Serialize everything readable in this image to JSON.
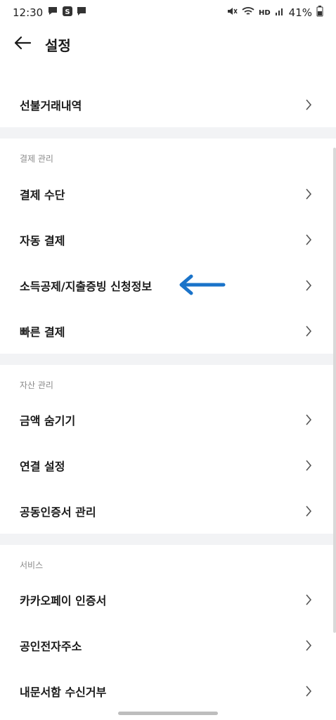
{
  "status_bar": {
    "time": "12:30",
    "battery": "41%",
    "hd_label": "HD"
  },
  "header": {
    "title": "설정"
  },
  "top_item": {
    "label": "선불거래내역"
  },
  "sections": [
    {
      "header": "결제 관리",
      "items": [
        "결제 수단",
        "자동 결제",
        "소득공제/지출증빙 신청정보",
        "빠른 결제"
      ]
    },
    {
      "header": "자산 관리",
      "items": [
        "금액 숨기기",
        "연결 설정",
        "공동인증서 관리"
      ]
    },
    {
      "header": "서비스",
      "items": [
        "카카오페이 인증서",
        "공인전자주소",
        "내문서함 수신거부"
      ]
    }
  ],
  "colors": {
    "accent_arrow": "#1a73c9",
    "separator": "#f2f3f5"
  },
  "icons": {
    "back": "arrow-left-icon",
    "chevron": "chevron-right-icon"
  }
}
